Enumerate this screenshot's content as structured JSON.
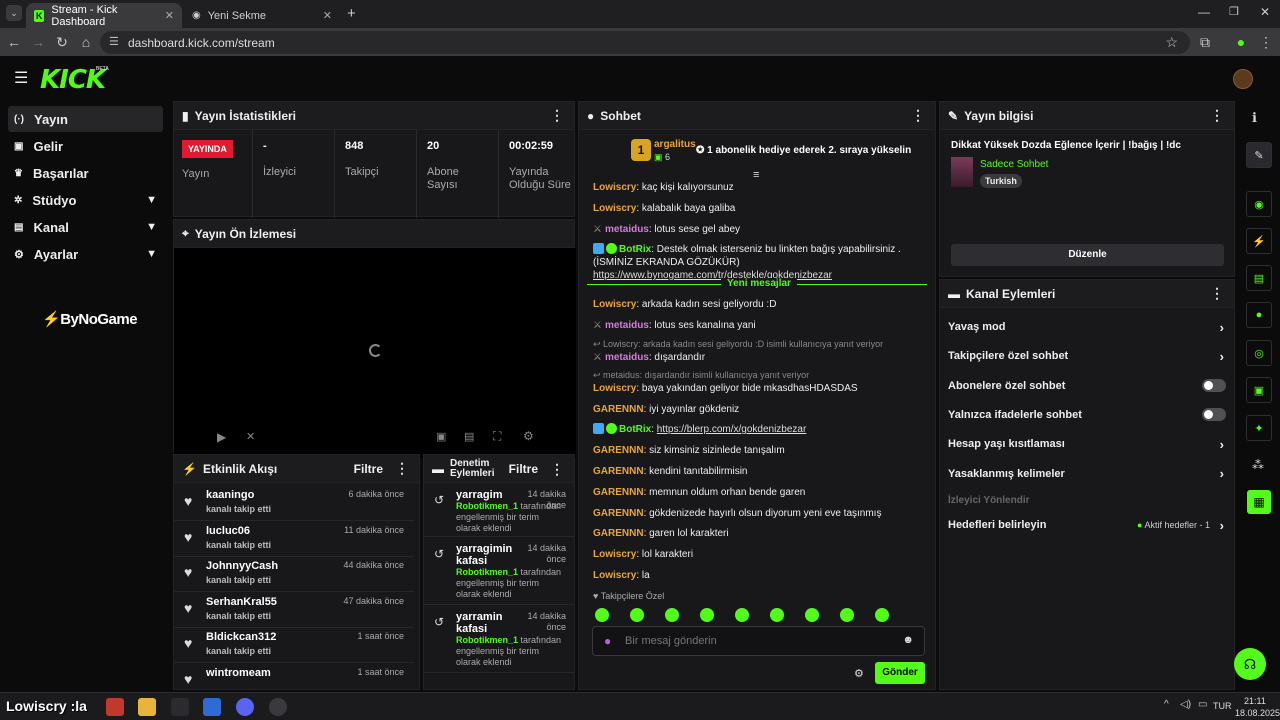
{
  "browser": {
    "tabs": [
      {
        "title": "Stream - Kick Dashboard",
        "active": true
      },
      {
        "title": "Yeni Sekme",
        "active": false
      }
    ],
    "url": "dashboard.kick.com/stream"
  },
  "kick": {
    "logo": "KICK",
    "beta": "BETA"
  },
  "sidebar": {
    "items": [
      {
        "label": "Yayın",
        "icon": "broadcast-icon"
      },
      {
        "label": "Gelir",
        "icon": "revenue-icon"
      },
      {
        "label": "Başarılar",
        "icon": "trophy-icon"
      },
      {
        "label": "Stüdyo",
        "icon": "studio-icon"
      },
      {
        "label": "Kanal",
        "icon": "channel-icon"
      },
      {
        "label": "Ayarlar",
        "icon": "gear-icon"
      }
    ],
    "sponsor": "ByNoGame"
  },
  "stats": {
    "title": "Yayın İstatistikleri",
    "live_badge": "YAYINDA",
    "live_label": "Yayın",
    "viewers_value": "-",
    "viewers_label": "İzleyici",
    "followers_value": "848",
    "followers_label": "Takipçi",
    "subs_value": "20",
    "subs_label": "Abone Sayısı",
    "duration_value": "00:02:59",
    "duration_label": "Yayında Olduğu Süre"
  },
  "preview": {
    "title": "Yayın Ön İzlemesi"
  },
  "activity": {
    "title": "Etkinlik Akışı",
    "filter": "Filtre",
    "items": [
      {
        "name": "kaaningo",
        "action": "kanalı takip etti",
        "time": "6 dakika önce"
      },
      {
        "name": "lucluc06",
        "action": "kanalı takip etti",
        "time": "11 dakika önce"
      },
      {
        "name": "JohnnyyCash",
        "action": "kanalı takip etti",
        "time": "44 dakika önce"
      },
      {
        "name": "SerhanKral55",
        "action": "kanalı takip etti",
        "time": "47 dakika önce"
      },
      {
        "name": "Bldickcan312",
        "action": "kanalı takip etti",
        "time": "1 saat önce"
      },
      {
        "name": "wintromeam",
        "action": "",
        "time": "1 saat önce"
      }
    ]
  },
  "moderation": {
    "title": "Denetim Eylemleri",
    "filter": "Filtre",
    "items": [
      {
        "name": "yarragim",
        "time": "14 dakika önce",
        "by": "Robotikmen_1",
        "desc": "tarafından engellenmiş bir terim olarak eklendi"
      },
      {
        "name": "yarragimin kafasi",
        "time": "14 dakika önce",
        "by": "Robotikmen_1",
        "desc": "tarafından engellenmiş bir terim olarak eklendi"
      },
      {
        "name": "yarramin kafasi",
        "time": "14 dakika önce",
        "by": "Robotikmen_1",
        "desc": "tarafından engellenmiş bir terim olarak eklendi"
      }
    ]
  },
  "chat": {
    "title": "Sohbet",
    "pinned_user": "argalitus",
    "pinned_rank": "1",
    "pinned_count": "6",
    "pinned_text": "1 abonelik hediye ederek 2. sıraya yükselin",
    "new_messages": "Yeni mesajlar",
    "followers_only": "Takipçilere Özel",
    "placeholder": "Bir mesaj gönderin",
    "send": "Gönder",
    "messages": [
      {
        "user": "Lowiscry",
        "color": "o",
        "text": ": kaç kişi kalıyorsunuz"
      },
      {
        "user": "Lowiscry",
        "color": "o",
        "text": ": kalabalık baya galiba"
      },
      {
        "user": "metaidus",
        "color": "p",
        "text": ": lotus sese gel abey"
      },
      {
        "user": "BotRix",
        "color": "g",
        "text": ": Destek olmak isterseniz bu linkten bağış yapabilirsiniz . (İSMİNİZ EKRANDA GÖZÜKÜR)",
        "link": "https://www.bynogame.com/tr/destekle/gokdenizbezar"
      },
      {
        "user": "Lowiscry",
        "color": "o",
        "text": ": arkada kadın sesi geliyordu :D"
      },
      {
        "user": "metaidus",
        "color": "p",
        "text": ": lotus ses kanalına yani"
      },
      {
        "user": "metaidus",
        "color": "p",
        "text": ": dışardandır",
        "reply": "Lowiscry: arkada kadın sesi geliyordu :D isimli kullanıcıya yanıt veriyor"
      },
      {
        "user": "Lowiscry",
        "color": "o",
        "text": ": baya yakından geliyor bide mkasdhasHDASDAS",
        "reply": "metaidus: dışardandır isimli kullanıcıya yanıt veriyor"
      },
      {
        "user": "GARENNN",
        "color": "o",
        "text": ": iyi yayınlar gökdeniz"
      },
      {
        "user": "BotRix",
        "color": "g",
        "text": ": ",
        "link": "https://blerp.com/x/gokdenizbezar"
      },
      {
        "user": "GARENNN",
        "color": "o",
        "text": ": siz kimsiniz sizinlede tanışalım"
      },
      {
        "user": "GARENNN",
        "color": "o",
        "text": ": kendini tanıtabilirmisin"
      },
      {
        "user": "GARENNN",
        "color": "o",
        "text": ": memnun oldum orhan bende garen"
      },
      {
        "user": "GARENNN",
        "color": "o",
        "text": ": gökdenizede hayırlı olsun diyorum yeni eve taşınmış"
      },
      {
        "user": "GARENNN",
        "color": "o",
        "text": ": garen lol karakteri"
      },
      {
        "user": "Lowiscry",
        "color": "o",
        "text": ": lol karakteri"
      },
      {
        "user": "Lowiscry",
        "color": "o",
        "text": ": la"
      }
    ]
  },
  "stream_info": {
    "title": "Yayın bilgisi",
    "stream_title": "Dikkat Yüksek Dozda Eğlence İçerir | !bağış | !dc",
    "category": "Sadece Sohbet",
    "language": "Turkish",
    "edit": "Düzenle"
  },
  "channel_actions": {
    "title": "Kanal Eylemleri",
    "items": [
      {
        "label": "Yavaş mod",
        "kind": "chevron"
      },
      {
        "label": "Takipçilere özel sohbet",
        "kind": "chevron"
      },
      {
        "label": "Abonelere özel sohbet",
        "kind": "toggle"
      },
      {
        "label": "Yalnızca ifadelerle sohbet",
        "kind": "toggle"
      },
      {
        "label": "Hesap yaşı kısıtlaması",
        "kind": "chevron"
      },
      {
        "label": "Yasaklanmış kelimeler",
        "kind": "chevron"
      }
    ],
    "redirect": "İzleyici Yönlendir",
    "goals": "Hedefleri belirleyin",
    "goals_status": "Aktif hedefler - 1"
  },
  "taskbar": {
    "overlay_text": "Lowiscry :la",
    "lang": "TUR",
    "time": "21:11",
    "date": "18.08.2025"
  },
  "colors": {
    "accent": "#53fc18",
    "live": "#e11a32"
  }
}
